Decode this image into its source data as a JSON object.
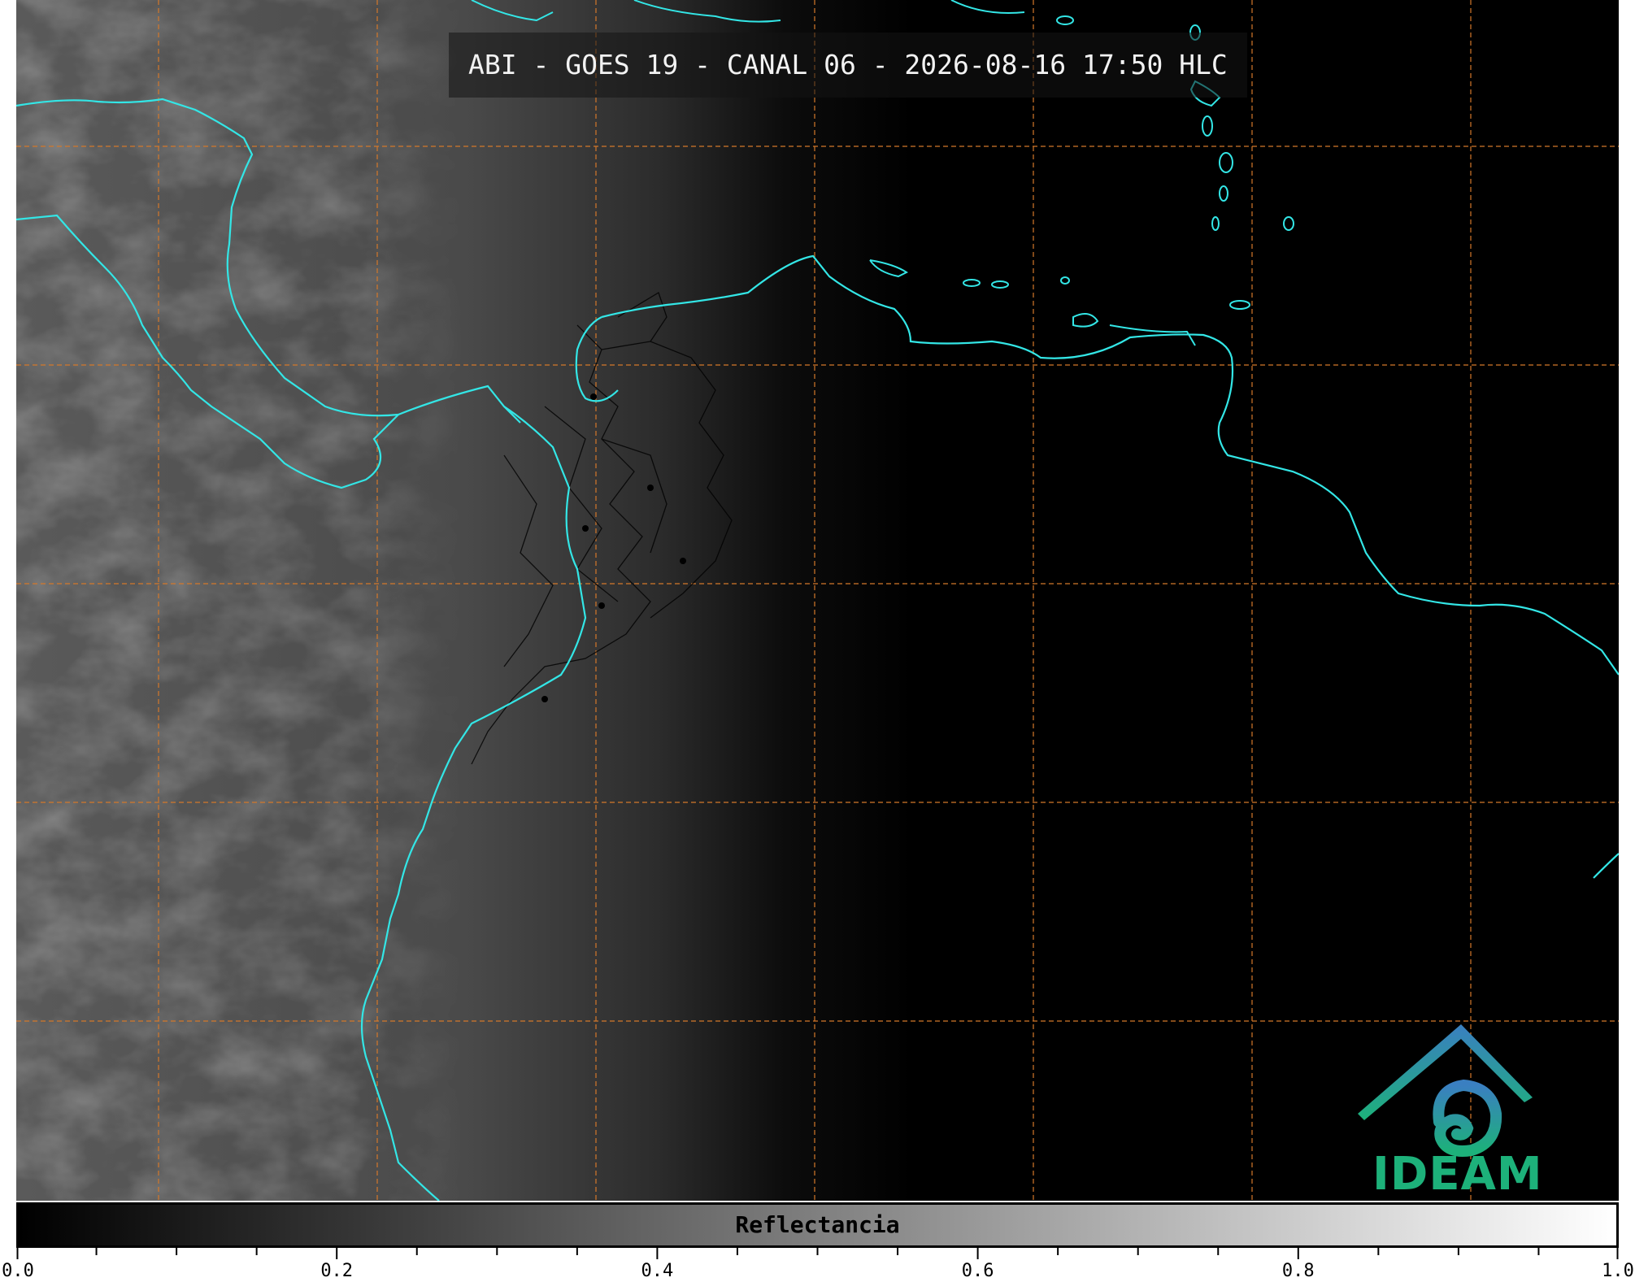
{
  "title": "ABI - GOES 19 - CANAL 06 - 2026-08-16 17:50 HLC",
  "colorbar": {
    "label": "Reflectancia",
    "min": 0.0,
    "max": 1.0,
    "tick_labels": [
      "0.0",
      "0.2",
      "0.4",
      "0.6",
      "0.8",
      "1.0"
    ],
    "colormap": "grayscale black-to-white"
  },
  "logo": {
    "text": "IDEAM",
    "text_color": "#1db17a",
    "mark_color_top": "#3a7fc1",
    "mark_color_bottom": "#1db17a"
  },
  "map": {
    "coastline_color": "#33e6e6",
    "gridline_color": "#d4782a",
    "border_color": "#000000",
    "background": "#000000"
  }
}
